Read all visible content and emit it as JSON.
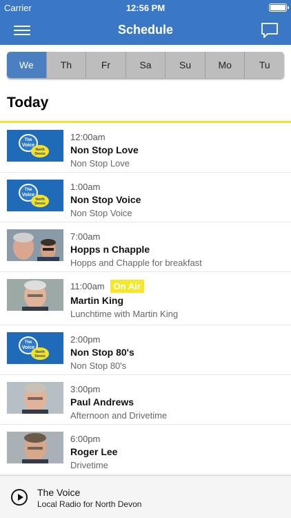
{
  "status_bar": {
    "carrier": "Carrier",
    "time": "12:56 PM"
  },
  "nav": {
    "title": "Schedule"
  },
  "colors": {
    "accent": "#3a77c4",
    "active_tab": "#4a7fc1",
    "highlight": "#f6e72c"
  },
  "days": [
    {
      "label": "We",
      "active": true
    },
    {
      "label": "Th",
      "active": false
    },
    {
      "label": "Fr",
      "active": false
    },
    {
      "label": "Sa",
      "active": false
    },
    {
      "label": "Su",
      "active": false
    },
    {
      "label": "Mo",
      "active": false
    },
    {
      "label": "Tu",
      "active": false
    }
  ],
  "section_title": "Today",
  "schedule": [
    {
      "time": "12:00am",
      "title": "Non Stop Love",
      "subtitle": "Non Stop Love",
      "image": "station-logo"
    },
    {
      "time": "1:00am",
      "title": "Non Stop Voice",
      "subtitle": "Non Stop Voice",
      "image": "station-logo"
    },
    {
      "time": "7:00am",
      "title": "Hopps n Chapple",
      "subtitle": "Hopps and Chapple for breakfast",
      "image": "presenter-photo"
    },
    {
      "time": "11:00am",
      "badge": "On Air",
      "title": "Martin King",
      "subtitle": "Lunchtime with Martin King",
      "image": "presenter-photo"
    },
    {
      "time": "2:00pm",
      "title": "Non Stop 80's",
      "subtitle": "Non Stop 80's",
      "image": "station-logo"
    },
    {
      "time": "3:00pm",
      "title": "Paul Andrews",
      "subtitle": "Afternoon and Drivetime",
      "image": "presenter-photo"
    },
    {
      "time": "6:00pm",
      "title": "Roger Lee",
      "subtitle": "Drivetime",
      "image": "presenter-photo"
    }
  ],
  "logo": {
    "line1": "The",
    "line2": "Voice",
    "line3": "North",
    "line4": "Devon"
  },
  "player": {
    "title": "The Voice",
    "subtitle": "Local Radio for North Devon"
  }
}
